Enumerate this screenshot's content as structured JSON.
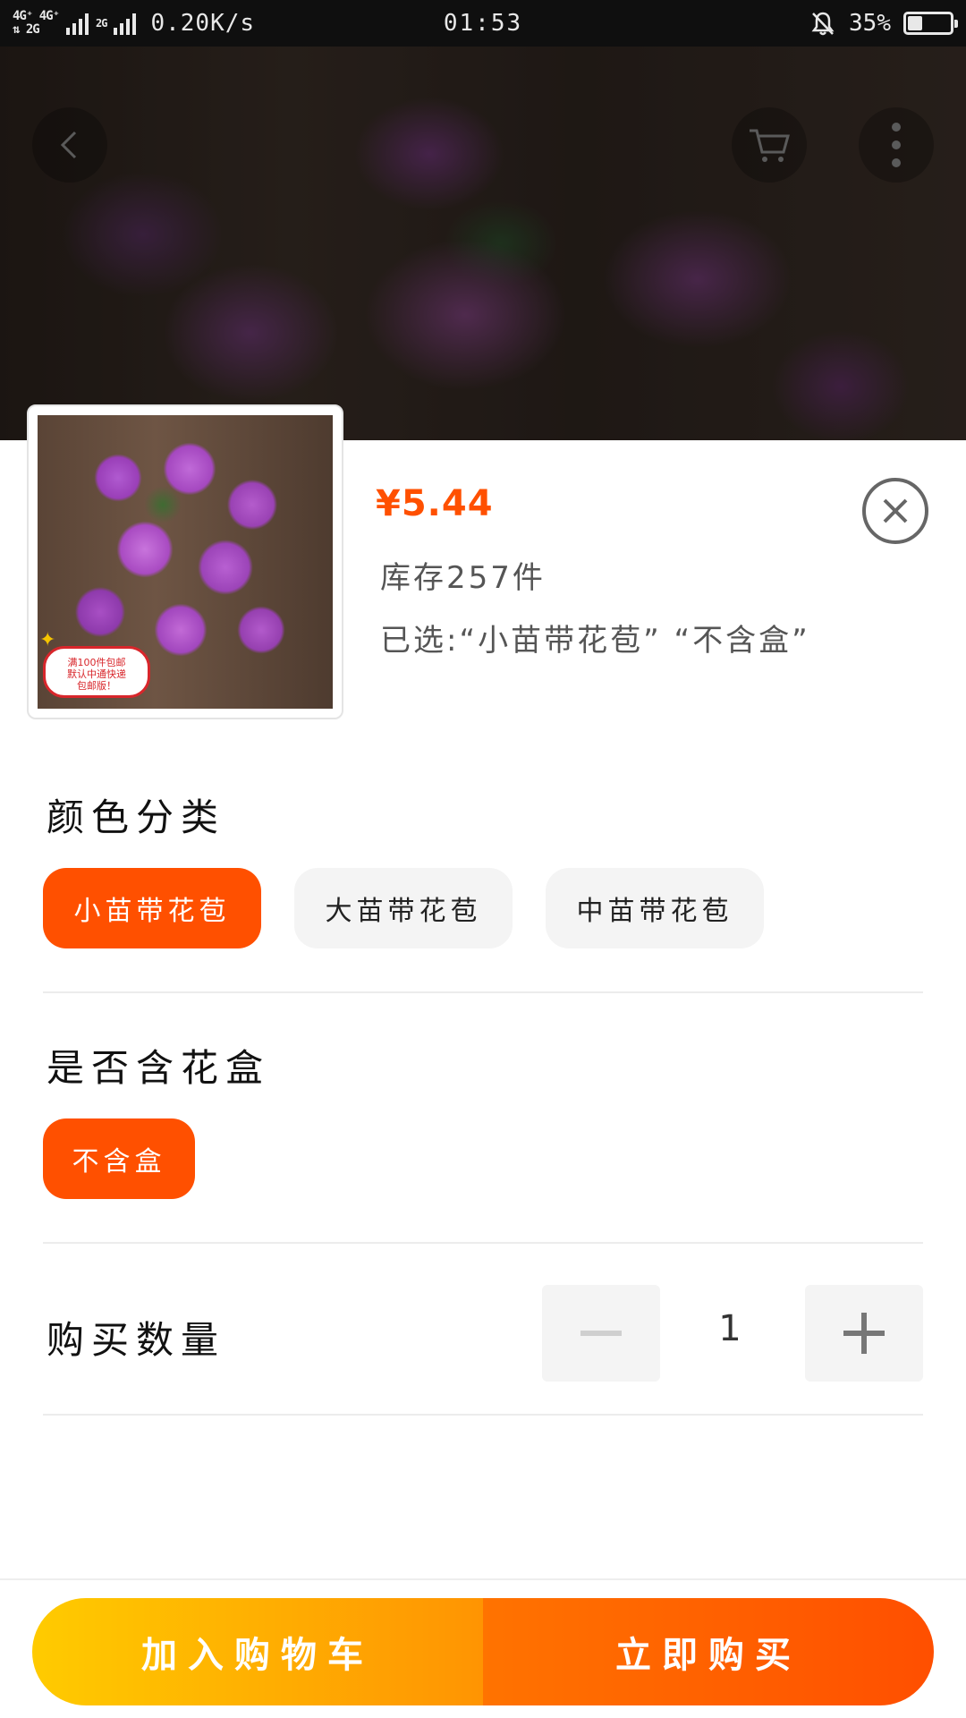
{
  "status_bar": {
    "network_line1": "4G⁺ 4G⁺",
    "network_line2": "⇅ 2G",
    "small_signal_label": "2G",
    "speed": "0.20K/s",
    "time": "01:53",
    "battery": "35%",
    "battery_level": 0.35
  },
  "product": {
    "price": "¥5.44",
    "stock": "库存257件",
    "selected": "已选:“小苗带花苞” “不含盒”",
    "thumb_badge_line1": "满100件包邮",
    "thumb_badge_line2": "默认中通快递",
    "thumb_badge_line3": "包邮版！"
  },
  "color_section": {
    "title": "颜色分类",
    "options": [
      {
        "label": "小苗带花苞",
        "selected": true
      },
      {
        "label": "大苗带花苞",
        "selected": false
      },
      {
        "label": "中苗带花苞",
        "selected": false
      }
    ]
  },
  "box_section": {
    "title": "是否含花盒",
    "options": [
      {
        "label": "不含盒",
        "selected": true
      }
    ]
  },
  "quantity": {
    "label": "购买数量",
    "value": "1"
  },
  "actions": {
    "add_to_cart": "加入购物车",
    "buy_now": "立即购买"
  },
  "colors": {
    "accent": "#ff5000",
    "cart_gradient_start": "#ffcb00",
    "cart_gradient_end": "#ff9402",
    "buy_gradient_start": "#ff7300",
    "buy_gradient_end": "#ff4f00"
  }
}
